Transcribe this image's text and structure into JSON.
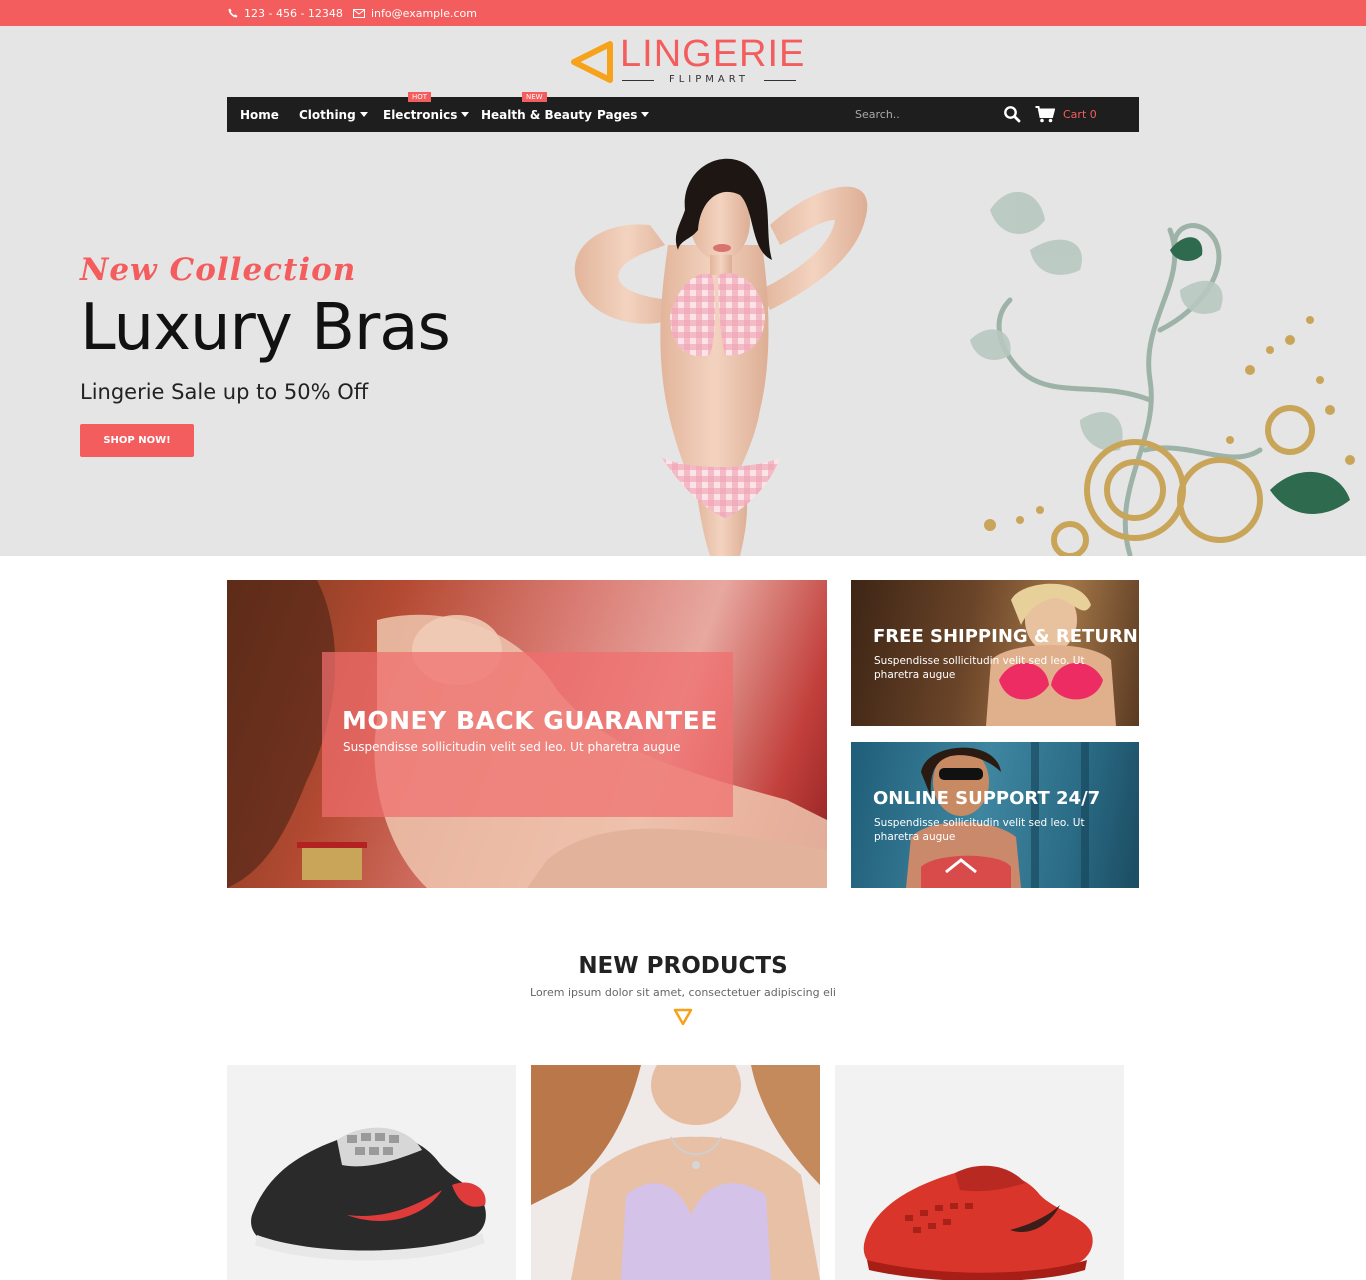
{
  "topbar": {
    "phone": "123 - 456 - 12348",
    "email": "info@example.com",
    "icons": {
      "phone": "phone-icon",
      "email": "envelope-icon"
    }
  },
  "logo": {
    "title": "LINGERIE",
    "subtitle": "FLIPMART",
    "mark": "triangle-logo-icon"
  },
  "nav": {
    "items": [
      {
        "label": "Home",
        "dropdown": false,
        "badge": ""
      },
      {
        "label": "Clothing",
        "dropdown": true,
        "badge": ""
      },
      {
        "label": "Electronics",
        "dropdown": true,
        "badge": "HOT"
      },
      {
        "label": "Health & Beauty",
        "dropdown": false,
        "badge": "NEW"
      },
      {
        "label": "Pages",
        "dropdown": true,
        "badge": ""
      }
    ],
    "search_placeholder": "Search..",
    "cart_label": "Cart 0"
  },
  "hero": {
    "kicker": "New Collection",
    "title": "Luxury Bras",
    "subtitle": "Lingerie Sale up to 50% Off",
    "button": "SHOP NOW!"
  },
  "promos": {
    "money_back": {
      "title": "MONEY BACK GUARANTEE",
      "text": "Suspendisse sollicitudin velit sed leo. Ut pharetra augue"
    },
    "free_shipping": {
      "title": "FREE SHIPPING & RETURN",
      "text": "Suspendisse sollicitudin velit sed leo. Ut pharetra augue"
    },
    "online_support": {
      "title": "ONLINE SUPPORT 24/7",
      "text": "Suspendisse sollicitudin velit sed leo. Ut pharetra augue"
    }
  },
  "new_products": {
    "title": "NEW PRODUCTS",
    "subtitle": "Lorem ipsum dolor sit amet, consectetuer adipiscing eli"
  },
  "colors": {
    "accent": "#f45d5d",
    "nav_bg": "#1e1e1e",
    "hero_bg": "#e6e5e6",
    "logo_mark": "#f7a21b"
  }
}
